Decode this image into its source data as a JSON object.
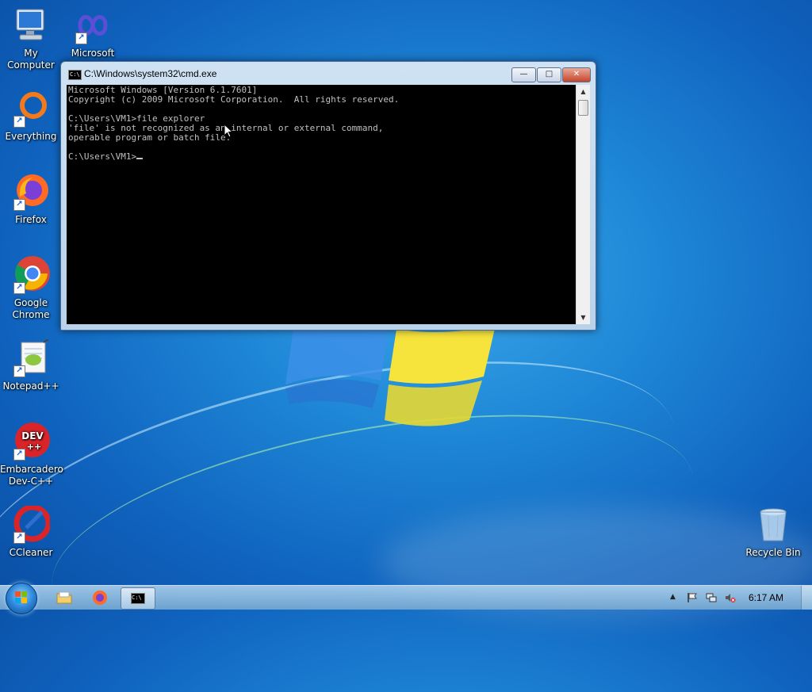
{
  "desktop": {
    "icons": [
      {
        "label": "My Computer"
      },
      {
        "label": "Microsoft"
      },
      {
        "label": "Everything"
      },
      {
        "label": "Firefox"
      },
      {
        "label": "Google Chrome"
      },
      {
        "label": "Notepad++"
      },
      {
        "label": "Embarcadero Dev-C++"
      },
      {
        "label": "CCleaner"
      },
      {
        "label": "Recycle Bin"
      }
    ]
  },
  "cmd_window": {
    "title": "C:\\Windows\\system32\\cmd.exe",
    "title_icon_text": "C:\\",
    "buttons": {
      "minimize": "—",
      "maximize": "□",
      "close": "✕"
    },
    "console_lines": [
      "Microsoft Windows [Version 6.1.7601]",
      "Copyright (c) 2009 Microsoft Corporation.  All rights reserved.",
      "",
      "C:\\Users\\VM1>file explorer",
      "'file' is not recognized as an internal or external command,",
      "operable program or batch file.",
      "",
      "C:\\Users\\VM1>"
    ]
  },
  "taskbar": {
    "clock": "6:17 AM",
    "items": [
      "file-explorer",
      "firefox",
      "command-prompt"
    ],
    "tray": [
      "show-hidden-icons",
      "action-center-flag",
      "network",
      "volume-muted"
    ]
  },
  "colors": {
    "console_bg": "#000000",
    "console_fg": "#c0c0c0",
    "desktop_blue": "#1e86d6"
  }
}
